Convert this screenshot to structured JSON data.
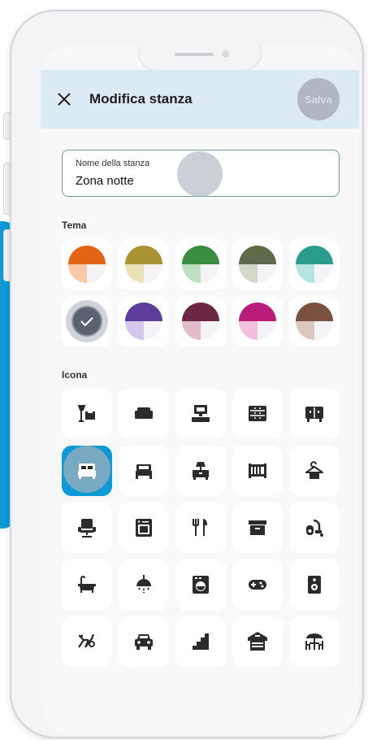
{
  "header": {
    "title": "Modifica stanza",
    "save_label": "Salva"
  },
  "room_name": {
    "label": "Nome della stanza",
    "value": "Zona notte"
  },
  "theme": {
    "label": "Tema",
    "selected_index": 5,
    "colors": [
      {
        "main": "#e36414",
        "light": "#fcc9a8"
      },
      {
        "main": "#a89334",
        "light": "#ece2b8"
      },
      {
        "main": "#3a8d3f",
        "light": "#bfe0c0"
      },
      {
        "main": "#5e6b4a",
        "light": "#d3d8c8"
      },
      {
        "main": "#2a9d8f",
        "light": "#b4e4dd"
      },
      {
        "main": "#5a6270",
        "light": "#c9ced6"
      },
      {
        "main": "#5d3d99",
        "light": "#d4c6ef"
      },
      {
        "main": "#6b2743",
        "light": "#e2bccb"
      },
      {
        "main": "#b81b7a",
        "light": "#f2bfdc"
      },
      {
        "main": "#7a5040",
        "light": "#ddc7bd"
      }
    ]
  },
  "icons": {
    "label": "Icona",
    "selected_index": 5,
    "items": [
      "lamp-chair-icon",
      "sofa-icon",
      "desk-icon",
      "dresser-icon",
      "sideboard-icon",
      "double-bed-icon",
      "single-bed-icon",
      "nightstand-icon",
      "crib-icon",
      "hanger-icon",
      "office-chair-icon",
      "oven-icon",
      "cutlery-icon",
      "archive-box-icon",
      "vacuum-icon",
      "bathtub-icon",
      "ceiling-lamp-icon",
      "washing-machine-icon",
      "gamepad-icon",
      "speaker-icon",
      "exercise-bike-icon",
      "car-icon",
      "stairs-icon",
      "garage-icon",
      "patio-table-icon"
    ]
  }
}
